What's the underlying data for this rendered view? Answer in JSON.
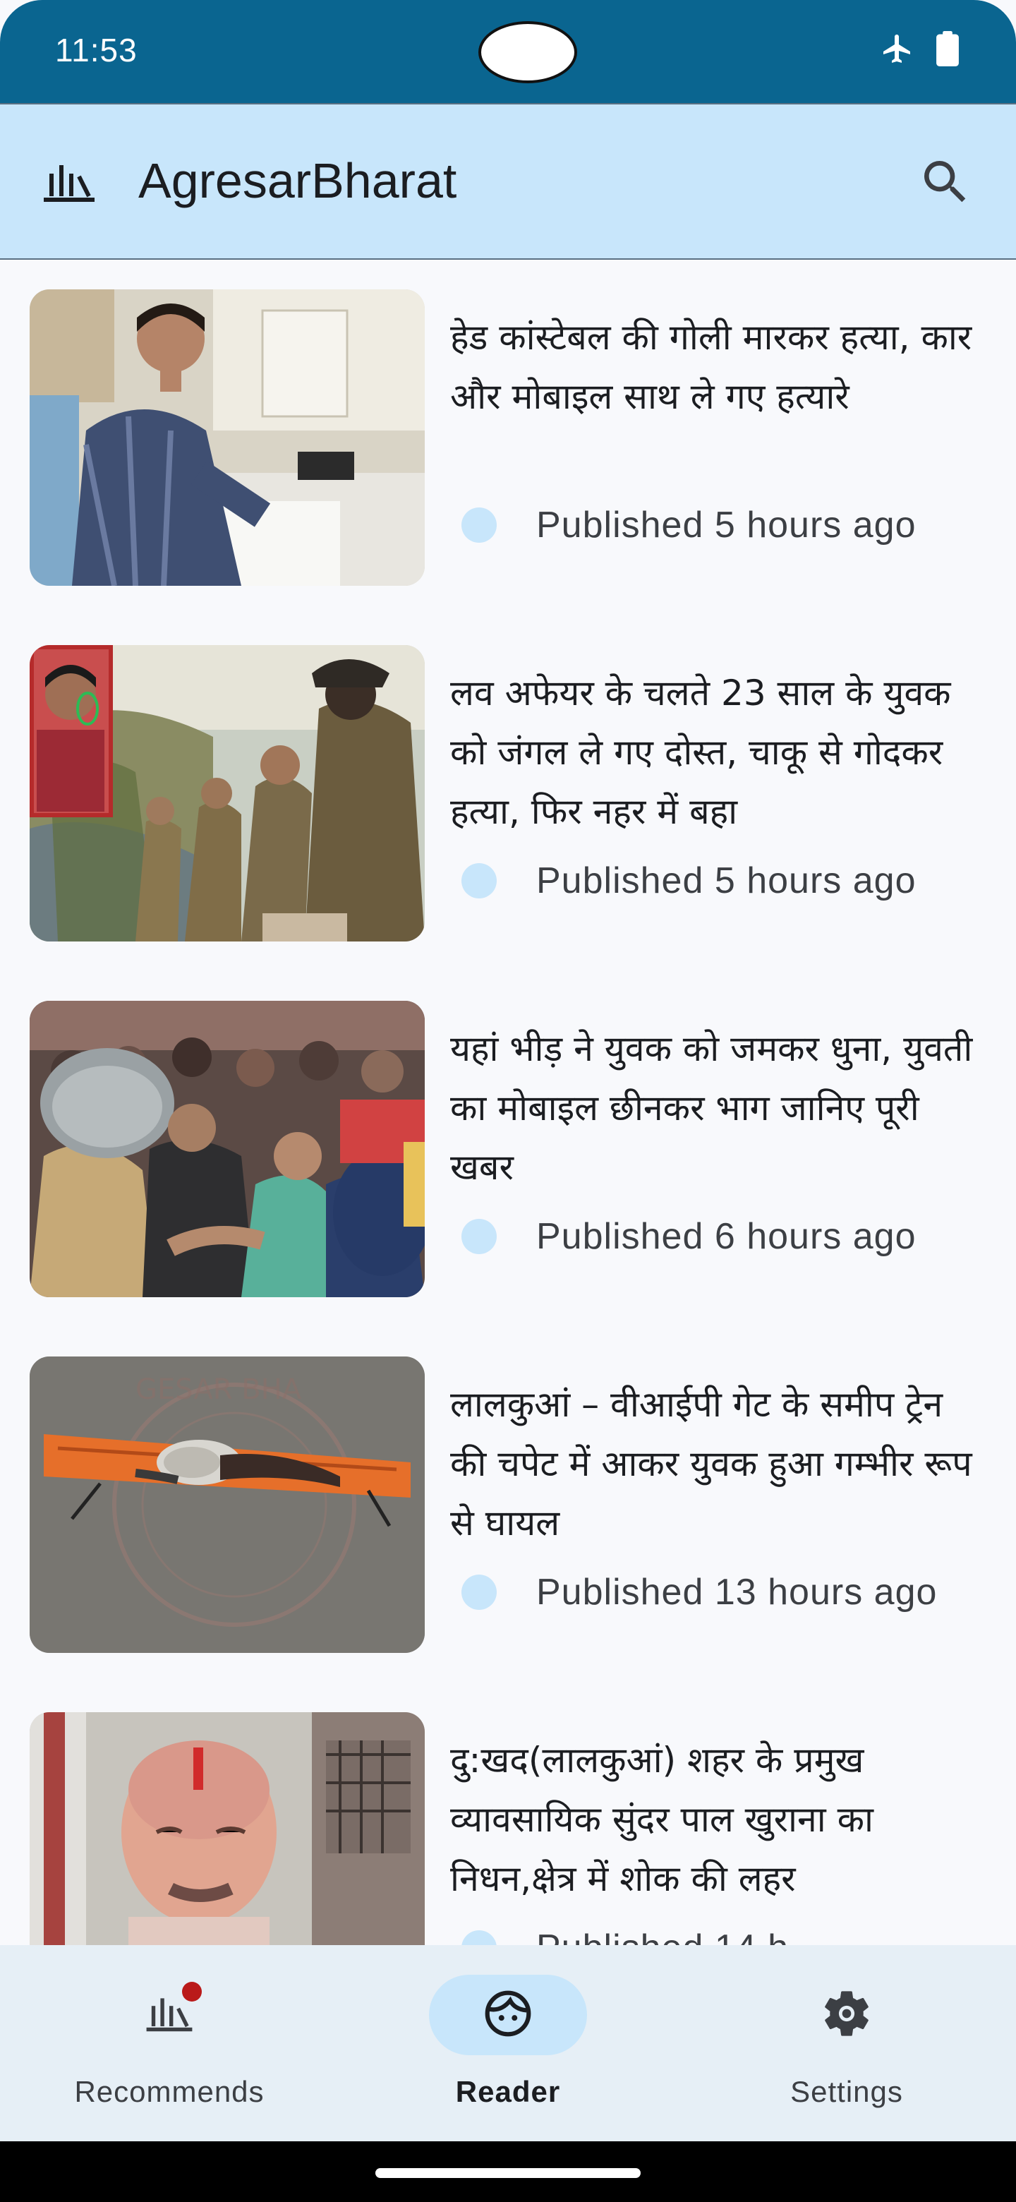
{
  "status_bar": {
    "time": "11:53",
    "icons": [
      "airplane-icon",
      "battery-icon"
    ]
  },
  "app_bar": {
    "title": "AgresarBharat",
    "menu_icon": "recommends-icon",
    "search_icon": "search-icon"
  },
  "articles": [
    {
      "title": "हेड कांस्टेबल की गोली मारकर हत्या, कार और मोबाइल साथ ले गए हत्यारे",
      "published": "Published 5 hours ago"
    },
    {
      "title": "लव अफेयर के चलते 23 साल के युवक को जंगल ले गए दोस्त, चाकू से गोदकर हत्या, फिर नहर में बहा",
      "published": "Published 5 hours ago"
    },
    {
      "title": "यहां भीड़ ने युवक को जमकर धुना, युवती का मोबाइल छीनकर भाग जानिए पूरी खबर",
      "published": "Published 6 hours ago"
    },
    {
      "title": "लालकुआं – वीआईपी गेट के समीप ट्रेन की चपेट में आकर युवक हुआ गम्भीर रूप से घायल",
      "published": "Published 13 hours ago"
    },
    {
      "title": "दु:खद(लालकुआं) शहर के प्रमुख व्यावसायिक सुंदर पाल खुराना का निधन,क्षेत्र में शोक की लहर",
      "published": "Published 14 h"
    }
  ],
  "bottom_nav": {
    "items": [
      {
        "label": "Recommends",
        "icon": "recommends-icon",
        "active": false,
        "badge": true
      },
      {
        "label": "Reader",
        "icon": "reader-face-icon",
        "active": true,
        "badge": false
      },
      {
        "label": "Settings",
        "icon": "gear-icon",
        "active": false,
        "badge": false
      }
    ]
  },
  "colors": {
    "status_bar": "#0a6590",
    "app_bar": "#c8e6fb",
    "background": "#f8f9fc",
    "nav_background": "#e6eff6",
    "badge": "#ba1a1a"
  }
}
